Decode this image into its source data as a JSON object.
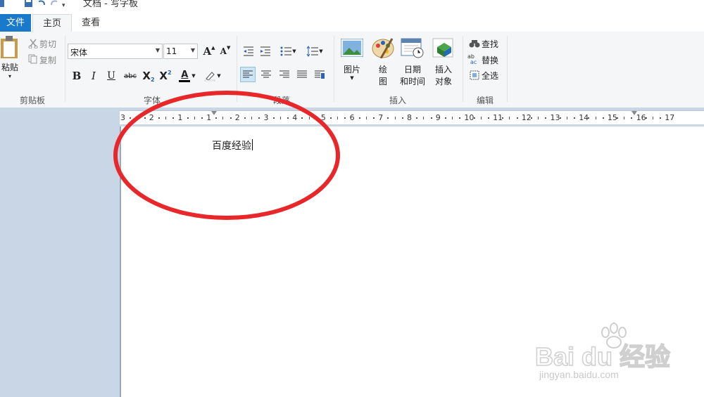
{
  "window": {
    "title": "文档 - 写字板"
  },
  "tabs": [
    {
      "label": "文件"
    },
    {
      "label": "主页"
    },
    {
      "label": "查看"
    }
  ],
  "clipboard": {
    "paste": "粘贴",
    "cut": "剪切",
    "copy": "复制",
    "group": "剪贴板"
  },
  "font": {
    "family": "宋体",
    "size": "11",
    "group": "字体",
    "bold": "B",
    "italic": "I",
    "underline": "U",
    "strike": "abc",
    "subscript": "X",
    "sub_mark": "2",
    "superscript": "X",
    "sup_mark": "2",
    "color_letter": "A",
    "grow": "A",
    "shrink": "A"
  },
  "paragraph": {
    "group": "段落"
  },
  "insert": {
    "picture": "图片",
    "paint1": "绘",
    "paint2": "图",
    "date1": "日期",
    "date2": "和时间",
    "object1": "插入",
    "object2": "对象",
    "group": "插入"
  },
  "editing": {
    "find": "查找",
    "replace": "替换",
    "select_all": "全选",
    "group": "编辑"
  },
  "ruler": {
    "labels": [
      "3",
      "2",
      "1",
      "1",
      "2",
      "3",
      "4",
      "5",
      "6",
      "7",
      "8",
      "9",
      "10",
      "11",
      "12",
      "13",
      "14",
      "15",
      "16",
      "17"
    ]
  },
  "document": {
    "text": "百度经验"
  },
  "watermark": {
    "brand": "Bai du 经验",
    "url": "jingyan.baidu.com"
  },
  "colors": {
    "file_tab": "#1979ca",
    "ribbon_bg": "#f5f6f7",
    "ruler_bg": "#c9d6e6",
    "annotation": "#e8272b"
  }
}
